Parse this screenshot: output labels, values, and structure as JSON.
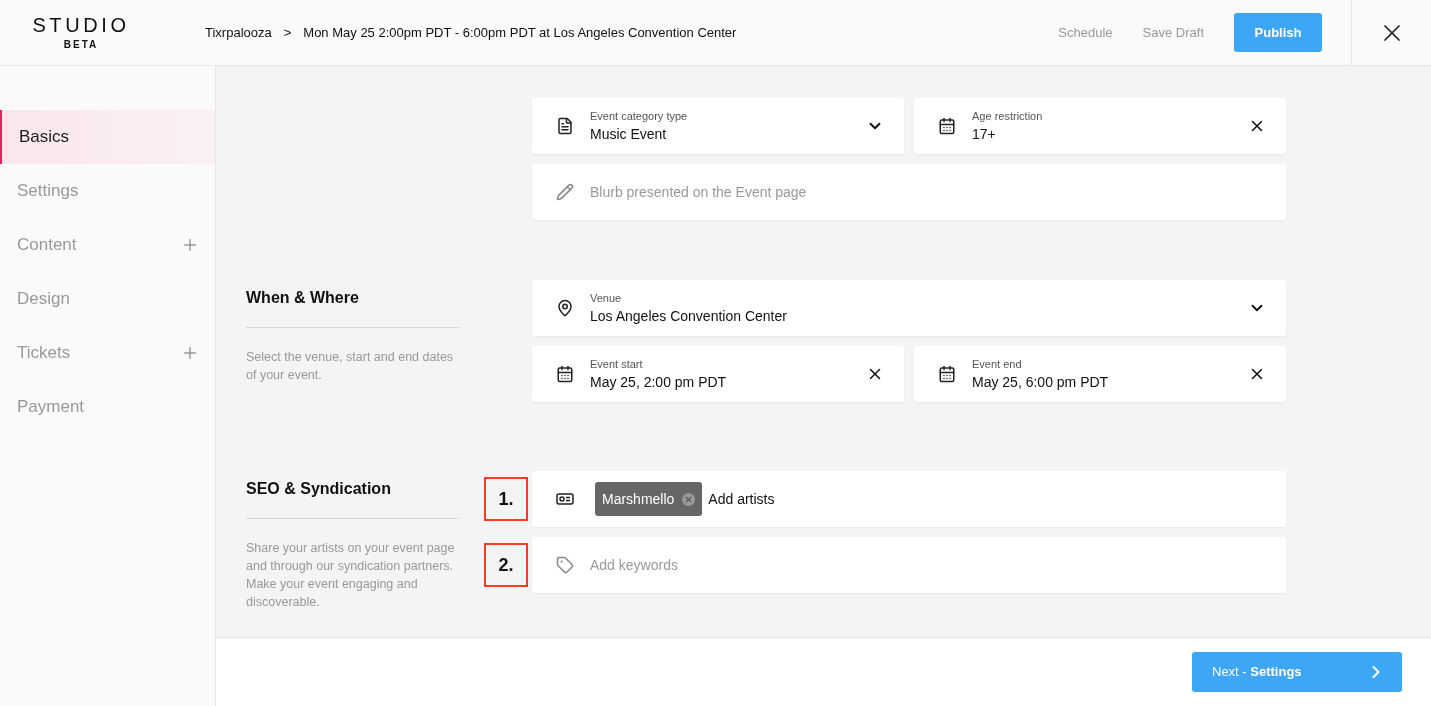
{
  "header": {
    "logo": {
      "title": "STUDIO",
      "subtitle": "BETA"
    },
    "breadcrumb": {
      "parent": "Tixrpalooza",
      "separator": ">",
      "current": "Mon May 25 2:00pm PDT - 6:00pm PDT at Los Angeles Convention Center"
    },
    "actions": [
      {
        "label": "Schedule",
        "kind": "link"
      },
      {
        "label": "Save Draft",
        "kind": "link"
      },
      {
        "label": "Publish",
        "kind": "primary"
      }
    ]
  },
  "sidebar": {
    "items": [
      {
        "label": "Basics",
        "selected": true,
        "expandable": false
      },
      {
        "label": "Settings",
        "selected": false,
        "expandable": false
      },
      {
        "label": "Content",
        "selected": false,
        "expandable": true
      },
      {
        "label": "Design",
        "selected": false,
        "expandable": false
      },
      {
        "label": "Tickets",
        "selected": false,
        "expandable": true
      },
      {
        "label": "Payment",
        "selected": false,
        "expandable": false
      }
    ]
  },
  "sections": [
    {
      "rows": [
        [
          {
            "kind": "category",
            "label": "Event category type",
            "value": "Music Event"
          },
          {
            "kind": "date",
            "label": "Age restriction",
            "value": "17+"
          }
        ],
        [
          {
            "kind": "blurb",
            "placeholder": "Blurb presented on the Event page"
          }
        ]
      ]
    },
    {
      "heading": "When & Where",
      "description": "Select the venue, start and end dates of your event.",
      "rows": [
        [
          {
            "kind": "venue",
            "label": "Venue",
            "value": "Los Angeles Convention Center"
          }
        ],
        [
          {
            "kind": "date",
            "label": "Event start",
            "value": "May 25, 2:00 pm PDT"
          },
          {
            "kind": "date",
            "label": "Event end",
            "value": "May 25, 6:00 pm PDT"
          }
        ]
      ]
    },
    {
      "heading": "SEO & Syndication",
      "description": "Share your artists on your event page and through our syndication partners. Make your event engaging and discoverable.",
      "rows": [
        [
          {
            "kind": "artists",
            "tags": [
              "Marshmello"
            ],
            "prompt": "Add artists",
            "marker": "1."
          }
        ],
        [
          {
            "kind": "keywords",
            "placeholder": "Add keywords",
            "marker": "2."
          }
        ]
      ]
    }
  ],
  "footer": {
    "next": "Next - **Settings**"
  }
}
